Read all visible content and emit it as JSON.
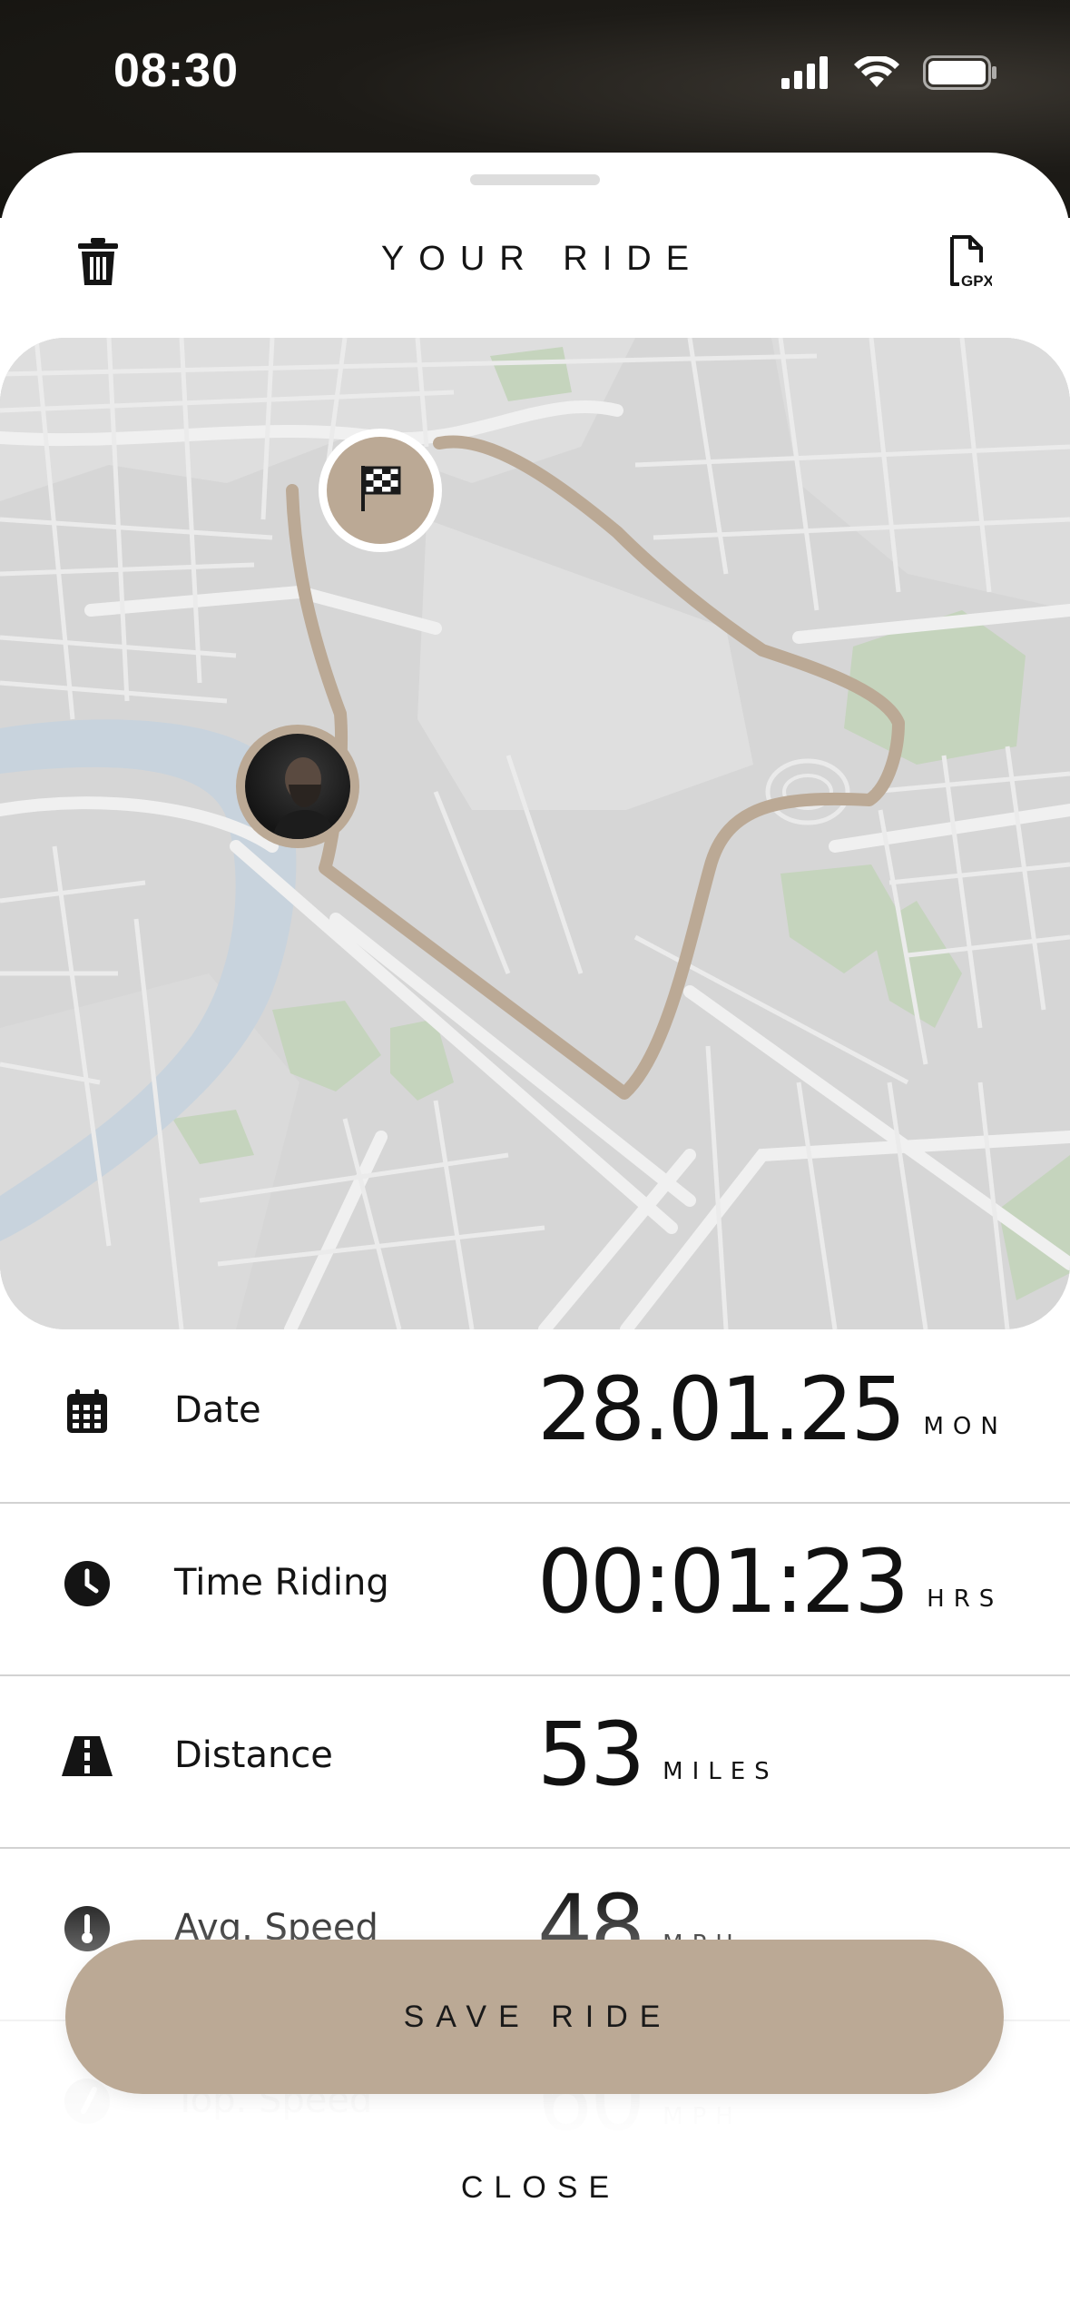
{
  "status_bar": {
    "time": "08:30"
  },
  "header": {
    "title": "YOUR RIDE",
    "delete_icon": "trash-icon",
    "export_icon": "gpx-file-icon",
    "export_label": "GPX"
  },
  "map": {
    "route_color": "#bba995",
    "start_marker": "rider-avatar",
    "finish_marker": "checkered-flag-icon"
  },
  "stats": [
    {
      "icon": "calendar-icon",
      "label": "Date",
      "value": "28.01.25",
      "unit": "MON"
    },
    {
      "icon": "clock-icon",
      "label": "Time Riding",
      "value": "00:01:23",
      "unit": "HRS"
    },
    {
      "icon": "road-icon",
      "label": "Distance",
      "value": "53",
      "unit": "MILES"
    },
    {
      "icon": "thermometer-icon",
      "label": "Avg. Speed",
      "value": "48",
      "unit": "MPH"
    },
    {
      "icon": "speedometer-icon",
      "label": "Top. Speed",
      "value": "60",
      "unit": "MPH"
    }
  ],
  "actions": {
    "save_label": "SAVE RIDE",
    "close_label": "CLOSE"
  },
  "colors": {
    "accent": "#bba995",
    "park": "#c5d4bd",
    "river": "#c8d3dd",
    "map_bg": "#d6d6d6"
  }
}
